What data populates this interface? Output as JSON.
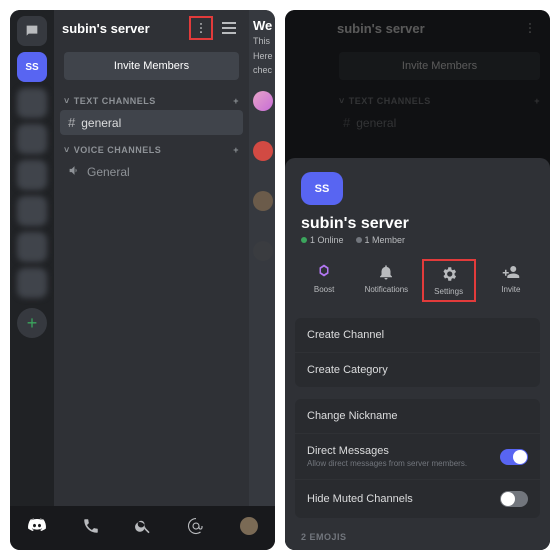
{
  "left": {
    "server_initials": "SS",
    "server_name": "subin's server",
    "invite_label": "Invite Members",
    "text_section": "TEXT CHANNELS",
    "voice_section": "VOICE CHANNELS",
    "text_channel": "general",
    "voice_channel": "General",
    "peek_heading": "We",
    "peek_line1": "This",
    "peek_line2": "Here",
    "peek_line3": "chec"
  },
  "right": {
    "server_initials": "SS",
    "server_name": "subin's server",
    "online": "1 Online",
    "members": "1 Member",
    "actions": {
      "boost": "Boost",
      "notifications": "Notifications",
      "settings": "Settings",
      "invite": "Invite"
    },
    "rows": {
      "create_channel": "Create Channel",
      "create_category": "Create Category",
      "change_nickname": "Change Nickname",
      "dm_title": "Direct Messages",
      "dm_sub": "Allow direct messages from server members.",
      "hide_muted": "Hide Muted Channels"
    },
    "footer": "2 EMOJIS"
  },
  "dim_invite": "Invite Members",
  "dim_text_section": "TEXT CHANNELS",
  "dim_channel": "general"
}
